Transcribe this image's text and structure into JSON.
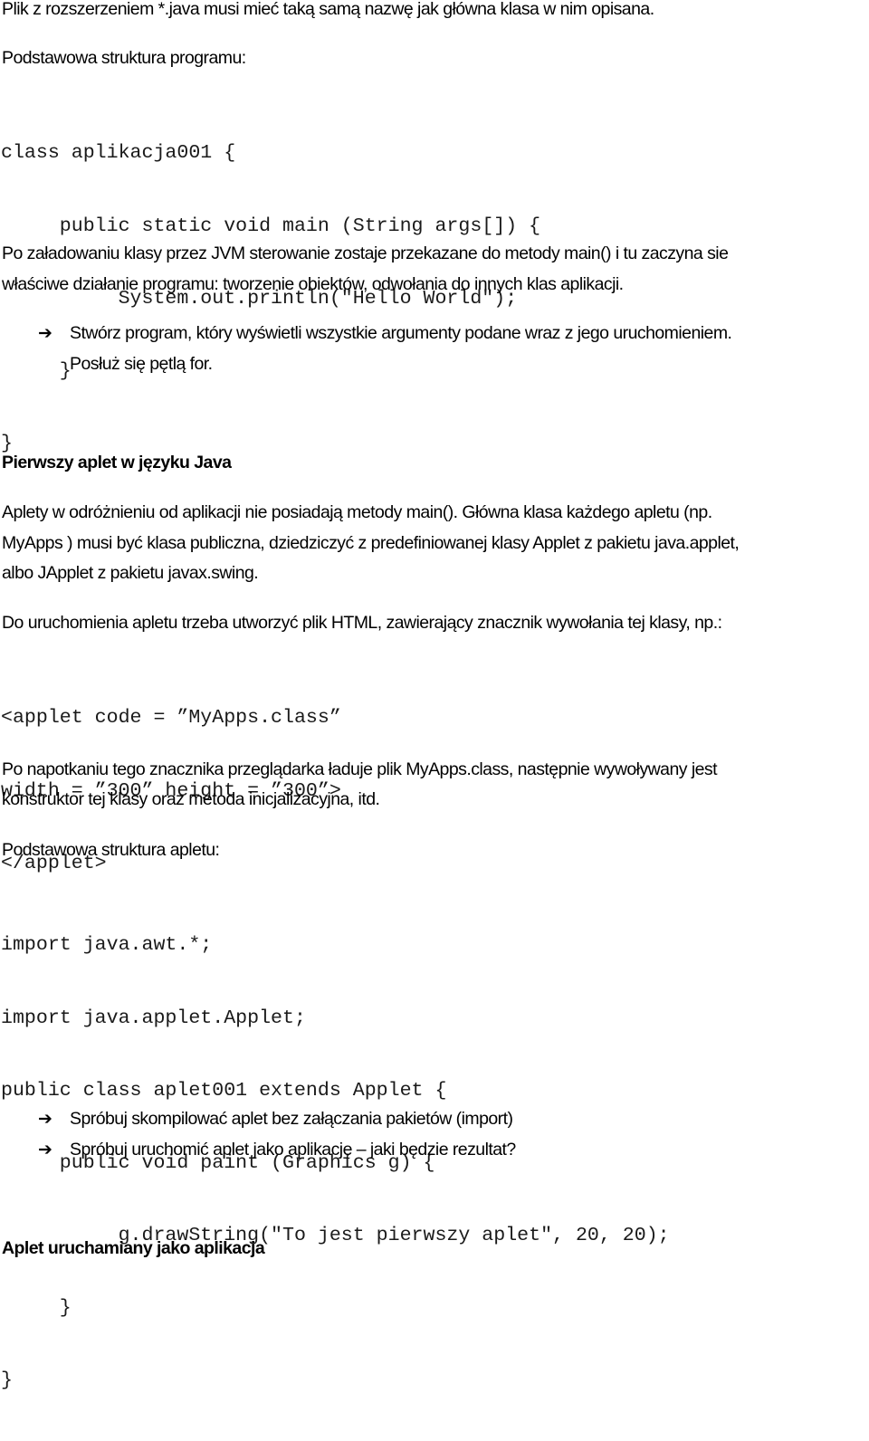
{
  "paragraphs": {
    "p1": "Plik z rozszerzeniem *.java musi mieć taką samą nazwę jak główna klasa w nim opisana.",
    "p2": "Podstawowa struktura programu:",
    "p3_line1": "Po załadowaniu klasy przez JVM sterowanie zostaje przekazane do metody main() i tu zaczyna sie",
    "p3_line2": "właściwe działanie programu: tworzenie obiektów, odwołania do innych klas aplikacji.",
    "task1_line1": "Stwórz program, który wyświetli wszystkie argumenty podane wraz z jego uruchomieniem.",
    "task1_line2": "Posłuż się pętlą for.",
    "heading1": "Pierwszy aplet w języku Java",
    "p4_line1": "Aplety w odróżnieniu od aplikacji nie posiadają metody main(). Główna klasa każdego apletu (np.",
    "p4_line2": "MyApps ) musi być klasa publiczna, dziedziczyć z predefiniowanej klasy Applet z pakietu java.applet,",
    "p4_line3": "albo JApplet z pakietu javax.swing.",
    "p5": "Do uruchomienia apletu trzeba utworzyć plik HTML, zawierający znacznik wywołania tej klasy, np.:",
    "p6_line1": "Po napotkaniu tego znacznika przeglądarka ładuje plik MyApps.class, następnie wywoływany jest",
    "p6_line2": "konstruktor tej klasy oraz metoda inicjalizacyjna, itd.",
    "p7": "Podstawowa struktura apletu:",
    "task2": "Spróbuj skompilować aplet bez załączania pakietów (import)",
    "task3": "Spróbuj uruchomić aplet jako aplikację – jaki będzie rezultat?",
    "heading2": "Aplet uruchamiany jako aplikacja"
  },
  "icons": {
    "arrow": "➔"
  },
  "code_program": [
    "class aplikacja001 {",
    "     public static void main (String args[]) {",
    "          System.out.println(\"Hello World\");",
    "     }",
    "}"
  ],
  "code_html": [
    "<applet code = ”MyApps.class”",
    "width = ”300” height = ”300”>",
    "</applet>"
  ],
  "code_applet": [
    "import java.awt.*;",
    "import java.applet.Applet;",
    "public class aplet001 extends Applet {",
    "     public void paint (Graphics g) {",
    "          g.drawString(\"To jest pierwszy aplet\", 20, 20);",
    "     }",
    "}"
  ]
}
